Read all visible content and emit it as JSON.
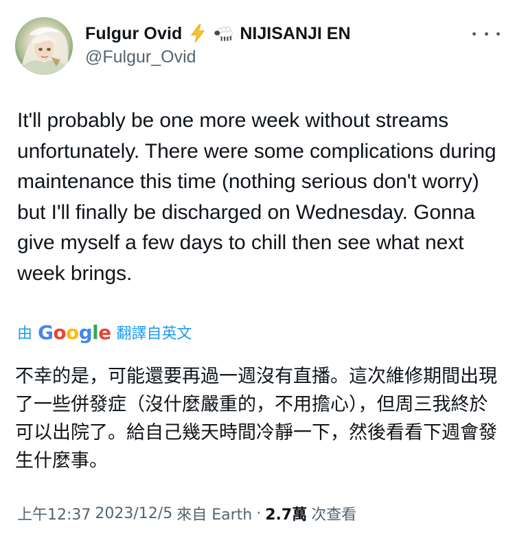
{
  "author": {
    "display_name": "Fulgur Ovid",
    "affiliation": "NIJISANJI EN",
    "handle": "@Fulgur_Ovid",
    "avatar_icon": "avatar-portrait",
    "badges": [
      "lightning-emoji",
      "sheep-emoji"
    ]
  },
  "more_menu_icon": "more-horizontal-icon",
  "tweet": {
    "text": "It'll probably be one more week without streams unfortunately. There were some complications during maintenance this time (nothing serious don't worry) but I'll finally be discharged on Wednesday. Gonna give myself a few days to chill then see what next week brings."
  },
  "translation": {
    "prefix": "由",
    "provider": "Google",
    "suffix": "翻譯自英文",
    "text": "不幸的是，可能還要再過一週沒有直播。這次維修期間出現了一些併發症（沒什麼嚴重的，不用擔心），但周三我終於可以出院了。給自己幾天時間冷靜一下，然後看看下週會發生什麼事。"
  },
  "meta": {
    "time": "上午12:37",
    "date": "2023/12/5",
    "source": "來自 Earth",
    "views_count": "2.7萬",
    "views_label": "次查看",
    "separator": "·"
  },
  "colors": {
    "text_primary": "#0f1419",
    "text_secondary": "#536471",
    "link": "#1d9bf0",
    "google_blue": "#4285F4",
    "google_red": "#EA4335",
    "google_yellow": "#FBBC05",
    "google_green": "#34A853"
  }
}
